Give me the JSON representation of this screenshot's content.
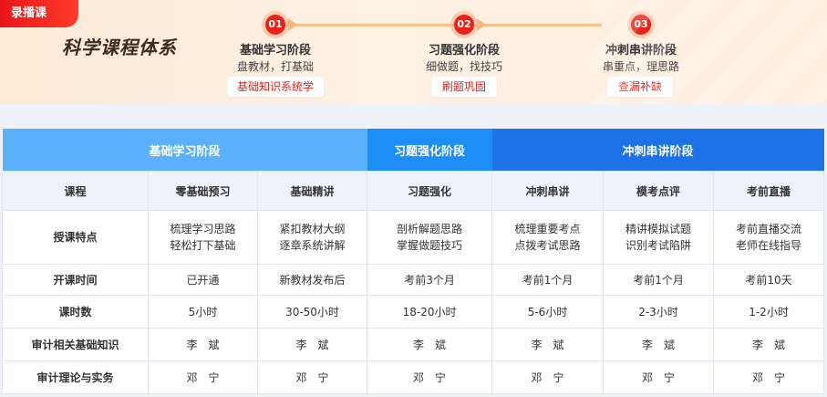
{
  "banner": {
    "tag": "录播课",
    "title": "科学课程体系",
    "stages": [
      {
        "num": "01",
        "name": "基础学习阶段",
        "sub": "盘教材，打基础",
        "button": "基础知识系统学"
      },
      {
        "num": "02",
        "name": "习题强化阶段",
        "sub": "细做题，找技巧",
        "button": "刷题巩固"
      },
      {
        "num": "03",
        "name": "冲刺串讲阶段",
        "sub": "串重点，理思路",
        "button": "查漏补缺"
      }
    ]
  },
  "table": {
    "phases": [
      "基础学习阶段",
      "习题强化阶段",
      "冲刺串讲阶段"
    ],
    "header": [
      "课程",
      "零基础预习",
      "基础精讲",
      "习题强化",
      "冲刺串讲",
      "模考点评",
      "考前直播"
    ],
    "rows": [
      {
        "label": "授课特点",
        "cells": [
          [
            "梳理学习思路",
            "轻松打下基础"
          ],
          [
            "紧扣教材大纲",
            "逐章系统讲解"
          ],
          [
            "剖析解题思路",
            "掌握做题技巧"
          ],
          [
            "梳理重要考点",
            "点拨考试思路"
          ],
          [
            "精讲模拟试题",
            "识别考试陷阱"
          ],
          [
            "考前直播交流",
            "老师在线指导"
          ]
        ]
      },
      {
        "label": "开课时间",
        "cells": [
          "已开通",
          "新教材发布后",
          "考前3个月",
          "考前1个月",
          "考前1个月",
          "考前10天"
        ]
      },
      {
        "label": "课时数",
        "cells": [
          "5小时",
          "30-50小时",
          "18-20小时",
          "5-6小时",
          "2-3小时",
          "1-2小时"
        ]
      },
      {
        "label": "审计相关基础知识",
        "cells": [
          "李　斌",
          "李　斌",
          "李　斌",
          "李　斌",
          "李　斌",
          "李　斌"
        ]
      },
      {
        "label": "审计理论与实务",
        "cells": [
          "邓　宁",
          "邓　宁",
          "邓　宁",
          "邓　宁",
          "邓　宁",
          "邓　宁"
        ]
      }
    ]
  }
}
